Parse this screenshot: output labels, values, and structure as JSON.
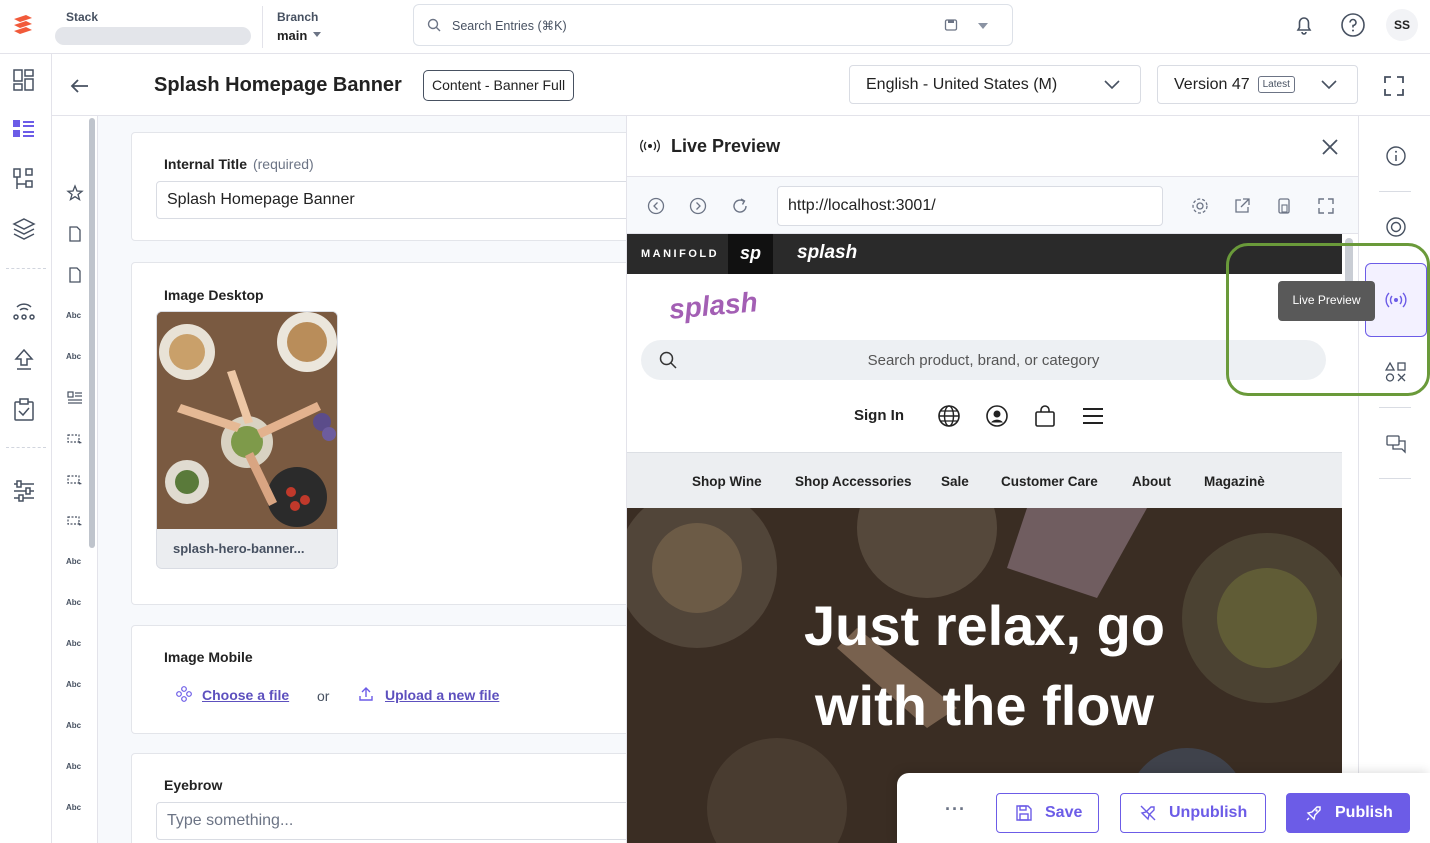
{
  "topbar": {
    "stack_label": "Stack",
    "branch_label": "Branch",
    "branch_value": "main",
    "search_placeholder": "Search Entries (⌘K)",
    "avatar_initials": "SS"
  },
  "entry": {
    "title": "Splash Homepage Banner",
    "content_type": "Content - Banner Full",
    "locale": "English - United States (M)",
    "version": "Version 47",
    "version_badge": "Latest"
  },
  "form": {
    "internal_title_label": "Internal Title",
    "internal_title_required": "(required)",
    "internal_title_value": "Splash Homepage Banner",
    "image_desktop_label": "Image Desktop",
    "image_desktop_filename": "splash-hero-banner...",
    "image_mobile_label": "Image Mobile",
    "choose_file": "Choose a file",
    "or_text": "or",
    "upload_file": "Upload a new file",
    "eyebrow_label": "Eyebrow",
    "eyebrow_placeholder": "Type something..."
  },
  "field_rail": {
    "text_marker": "Abc"
  },
  "preview": {
    "title": "Live Preview",
    "url": "http://localhost:3001/",
    "site": {
      "brand_manifold": "MANIFOLD",
      "brand_sp": "sp",
      "brand_splash": "splash",
      "logo": "splash",
      "search_placeholder": "Search product, brand, or category",
      "sign_in": "Sign In",
      "nav": [
        "Shop Wine",
        "Shop Accessories",
        "Sale",
        "Customer Care",
        "About",
        "Magazinè"
      ],
      "hero_lines": [
        "Just relax, go",
        "with the flow"
      ]
    }
  },
  "right_rail": {
    "tooltip": "Live Preview"
  },
  "actions": {
    "more": "···",
    "save": "Save",
    "unpublish": "Unpublish",
    "publish": "Publish"
  },
  "colors": {
    "accent": "#6c5ce7",
    "highlight_ring": "#6a9a3a",
    "logo_purple": "#a35fb4"
  }
}
